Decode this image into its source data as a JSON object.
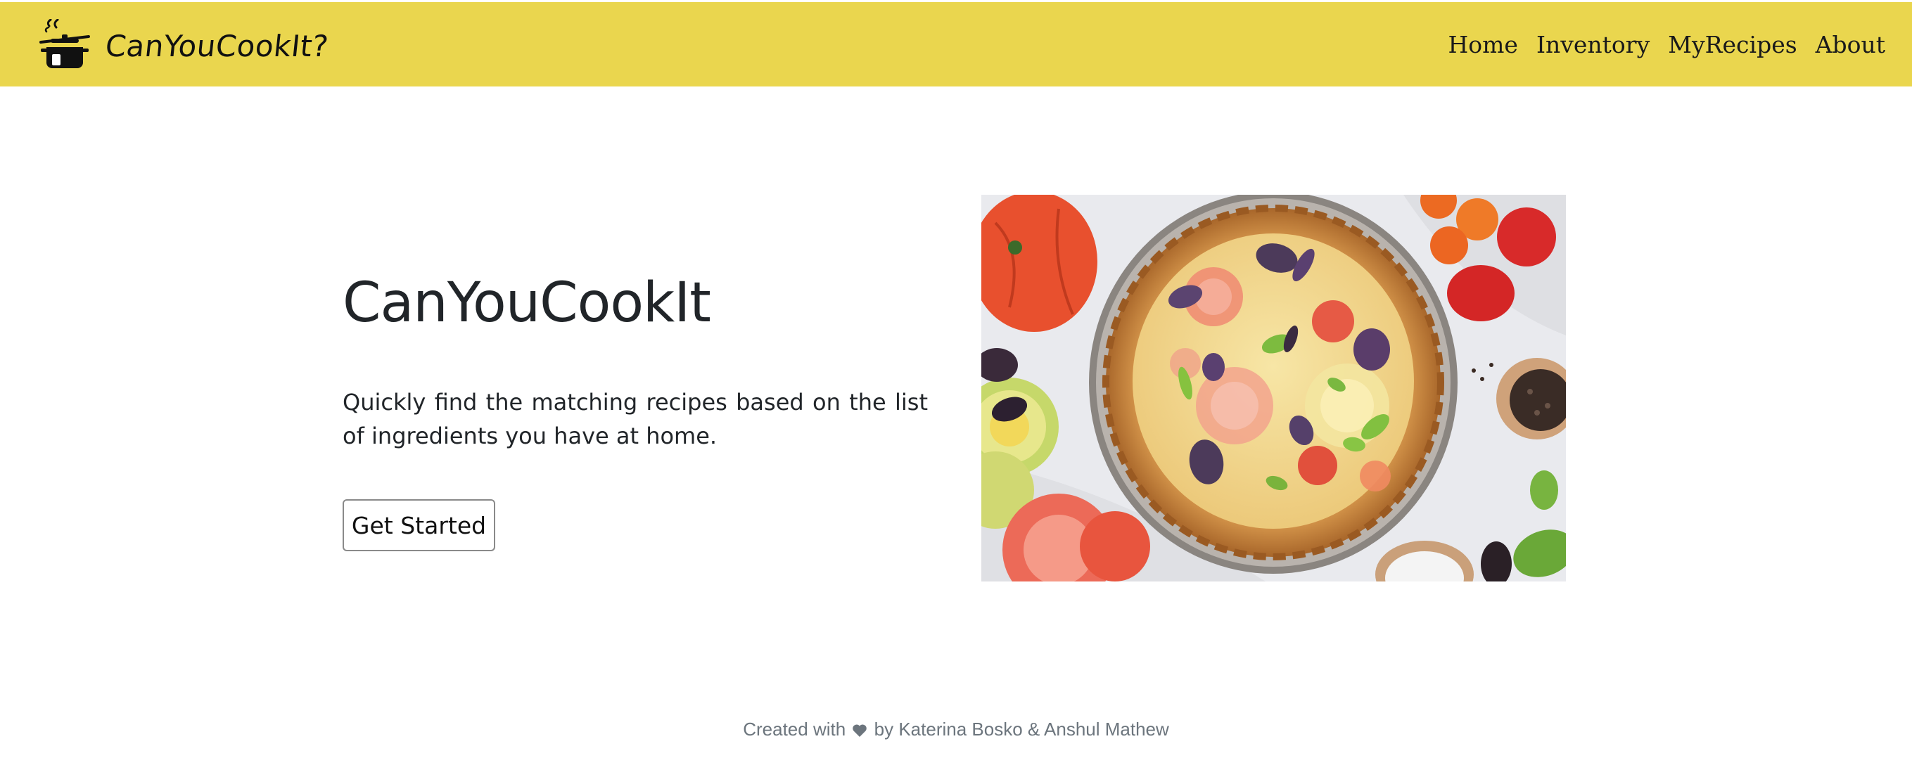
{
  "navbar": {
    "brand_name": "CanYouCookIt?",
    "brand_icon": "cooking-pot-icon",
    "background": "#ead64e",
    "links": [
      {
        "label": "Home"
      },
      {
        "label": "Inventory"
      },
      {
        "label": "MyRecipes"
      },
      {
        "label": "About"
      }
    ]
  },
  "hero": {
    "title": "CanYouCookIt",
    "description": "Quickly find the matching recipes based on the list of ingredients you have at home.",
    "cta_label": "Get Started",
    "image_subject": "tomato-quiche-photo"
  },
  "footer": {
    "prefix": "Created with",
    "icon": "heart-icon",
    "suffix": "by Katerina Bosko & Anshul Mathew"
  }
}
